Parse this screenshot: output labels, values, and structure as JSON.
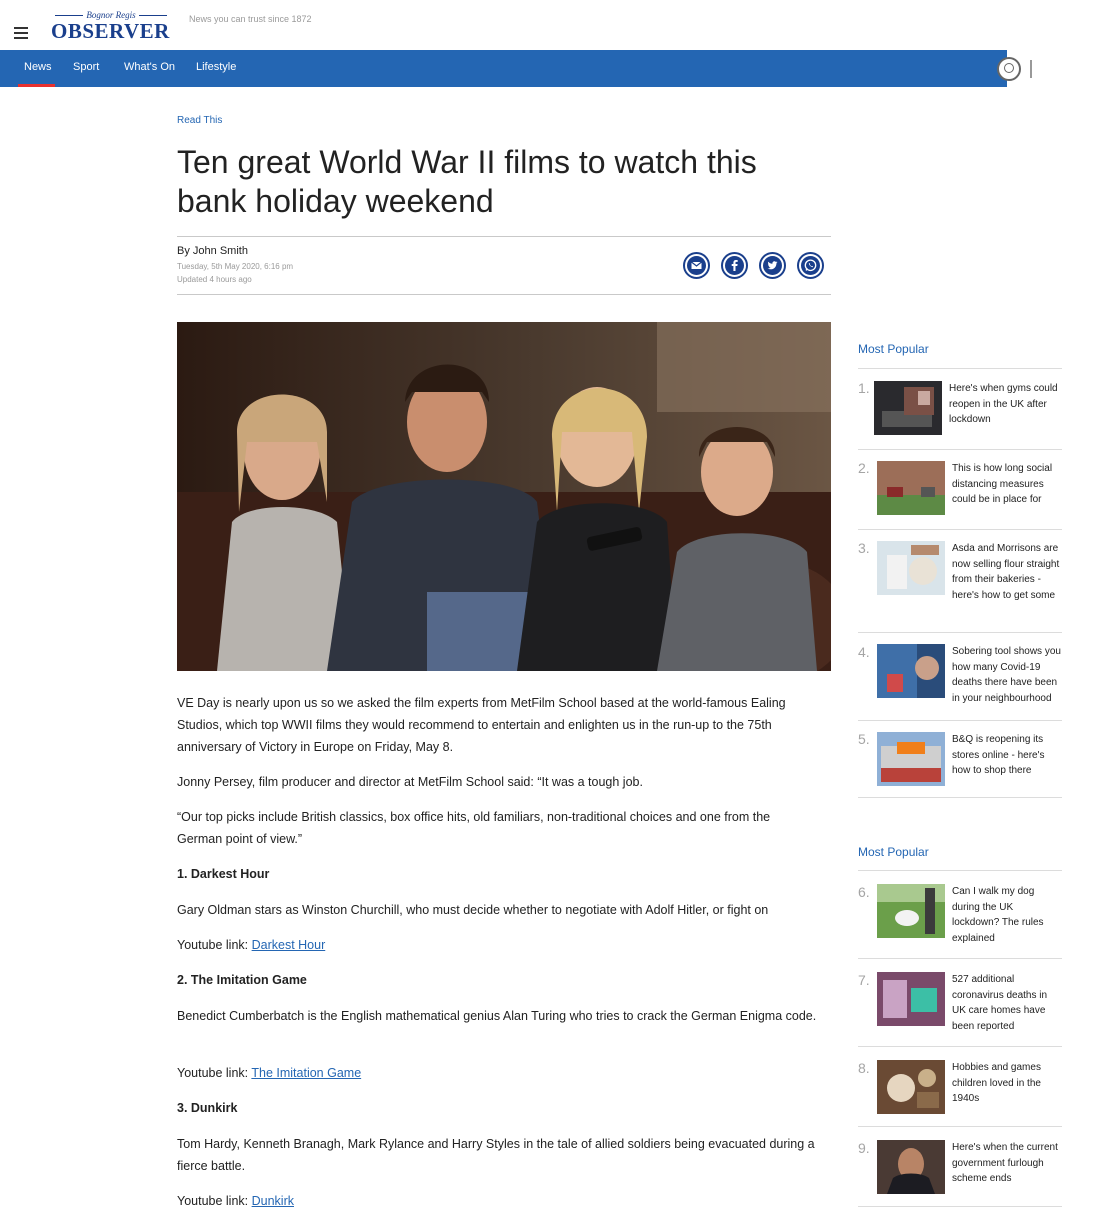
{
  "header": {
    "logo_small": "Bognor Regis",
    "logo_big": "OBSERVER",
    "tagline": "News you can trust since 1872"
  },
  "nav": {
    "items": [
      "News",
      "Sport",
      "What's On",
      "Lifestyle"
    ],
    "active": "News"
  },
  "article": {
    "kicker": "Read This",
    "title": "Ten great World War II films to watch this bank holiday weekend",
    "byline_prefix": "By",
    "author": "John Smith",
    "date": "Tuesday, 5th May 2020, 6:16 pm",
    "updated": "Updated  4 hours ago",
    "paragraphs": {
      "p1": "VE Day is nearly upon us so we asked the film experts from MetFilm School based at the world-famous Ealing Studios, which top WWII films they would recommend to entertain and enlighten us in the run-up to the 75th anniversary of Victory in Europe on Friday, May 8.",
      "p2": "Jonny Persey, film producer and director at MetFilm School said: “It was a tough job.",
      "p3": "“Our top picks include British classics, box office hits, old familiars, non-traditional choices and one from the German point of view.”",
      "h1": "1. Darkest Hour",
      "d1": "Gary Oldman stars as Winston Churchill, who must decide whether to negotiate with Adolf Hitler, or fight on",
      "yt_label": "Youtube link: ",
      "l1": "Darkest Hour",
      "h2": "2. The Imitation Game",
      "d2": "Benedict Cumberbatch is the English mathematical genius Alan Turing who tries to crack the German Enigma code.",
      "l2": "The Imitation Game",
      "h3": "3. Dunkirk",
      "d3": "Tom Hardy, Kenneth Branagh, Mark Rylance and Harry Styles in the tale of allied soldiers being evacuated during a fierce battle.",
      "l3": "Dunkirk"
    }
  },
  "sidebar": {
    "title1": "Most Popular",
    "title2": "Most Popular",
    "items": [
      {
        "num": "1.",
        "text": "Here's when gyms could reopen in the UK after lockdown"
      },
      {
        "num": "2.",
        "text": "This is how long social distancing measures could be in place for"
      },
      {
        "num": "3.",
        "text": "Asda and Morrisons are now selling flour straight from their bakeries - here's how to get some"
      },
      {
        "num": "4.",
        "text": "Sobering tool shows you how many Covid-19 deaths there have been in your neighbourhood"
      },
      {
        "num": "5.",
        "text": "B&Q is reopening its stores online - here's how to shop there"
      },
      {
        "num": "6.",
        "text": "Can I walk my dog during the UK lockdown? The rules explained"
      },
      {
        "num": "7.",
        "text": "527 additional coronavirus deaths in UK care homes have been reported"
      },
      {
        "num": "8.",
        "text": "Hobbies and games children loved in the 1940s"
      },
      {
        "num": "9.",
        "text": "Here's when the current government furlough scheme ends"
      }
    ]
  },
  "colors": {
    "brand_blue": "#2466b3",
    "logo_blue": "#1a3f8c",
    "active_red": "#e8312f"
  }
}
